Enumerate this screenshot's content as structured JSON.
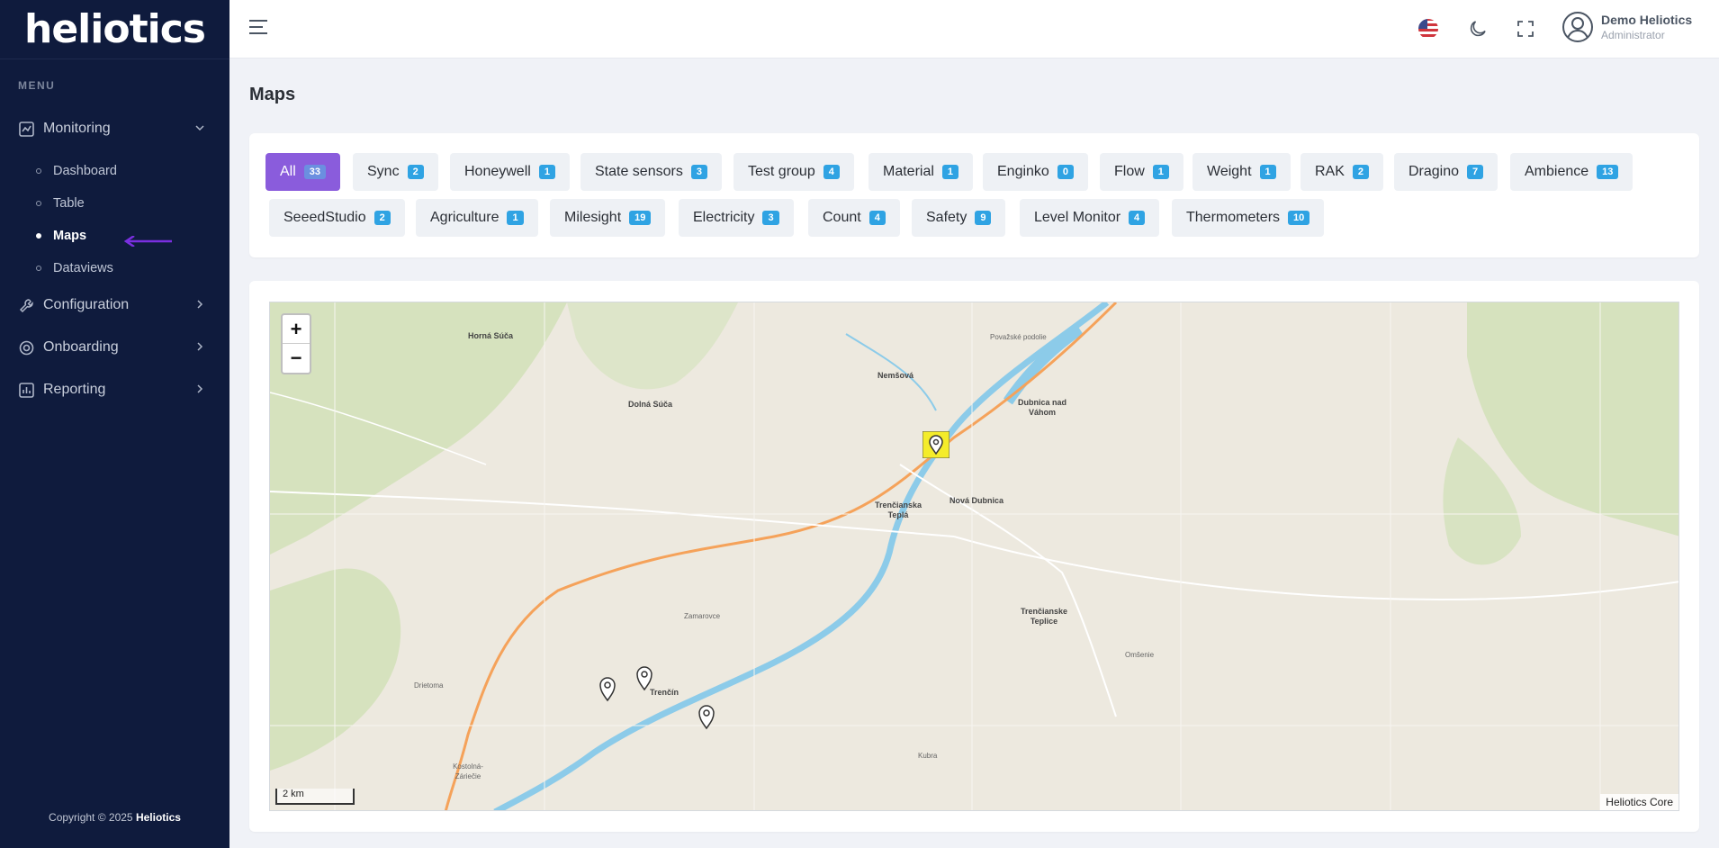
{
  "app": {
    "logo_text": "heliotics"
  },
  "sidebar": {
    "menu_title": "MENU",
    "items": [
      {
        "label": "Monitoring",
        "icon": "chart-line-icon"
      },
      {
        "label": "Configuration",
        "icon": "wrench-icon"
      },
      {
        "label": "Onboarding",
        "icon": "onboarding-icon"
      },
      {
        "label": "Reporting",
        "icon": "bar-chart-icon"
      }
    ],
    "sub_items": [
      "Dashboard",
      "Table",
      "Maps",
      "Dataviews"
    ],
    "active_sub_item": "Maps",
    "copyright_prefix": "Copyright © 2025",
    "copyright_brand": "Heliotics"
  },
  "topbar": {
    "user_name": "Demo Heliotics",
    "user_role": "Administrator",
    "icons": [
      "us-flag-icon",
      "moon-icon",
      "fullscreen-icon",
      "user-circle-icon"
    ]
  },
  "page": {
    "title": "Maps"
  },
  "filters": [
    {
      "label": "All",
      "count": "33",
      "active": true
    },
    {
      "label": "Sync",
      "count": "2"
    },
    {
      "label": "Honeywell",
      "count": "1"
    },
    {
      "label": "State sensors",
      "count": "3"
    },
    {
      "label": "Test group",
      "count": "4"
    },
    {
      "label": "Material",
      "count": "1"
    },
    {
      "label": "Enginko",
      "count": "0"
    },
    {
      "label": "Flow",
      "count": "1"
    },
    {
      "label": "Weight",
      "count": "1"
    },
    {
      "label": "RAK",
      "count": "2"
    },
    {
      "label": "Dragino",
      "count": "7"
    },
    {
      "label": "Ambience",
      "count": "13"
    },
    {
      "label": "SeeedStudio",
      "count": "2"
    },
    {
      "label": "Agriculture",
      "count": "1"
    },
    {
      "label": "Milesight",
      "count": "19"
    },
    {
      "label": "Electricity",
      "count": "3"
    },
    {
      "label": "Count",
      "count": "4"
    },
    {
      "label": "Safety",
      "count": "9"
    },
    {
      "label": "Level Monitor",
      "count": "4"
    },
    {
      "label": "Thermometers",
      "count": "10"
    }
  ],
  "map": {
    "zoom_in": "+",
    "zoom_out": "−",
    "scale": "2 km",
    "attribution": "Heliotics Core",
    "places": [
      "Horná Súča",
      "Dolná Súča",
      "Nemšová",
      "Dubnica nad Váhom",
      "Trenčianska Teplá",
      "Nová Dubnica",
      "Trenčianske Teplice",
      "Trenčín",
      "Považské podolie",
      "Zamarovce",
      "Kostolná-Záriečie",
      "Drietoma",
      "Kubra",
      "Omšenie"
    ]
  }
}
